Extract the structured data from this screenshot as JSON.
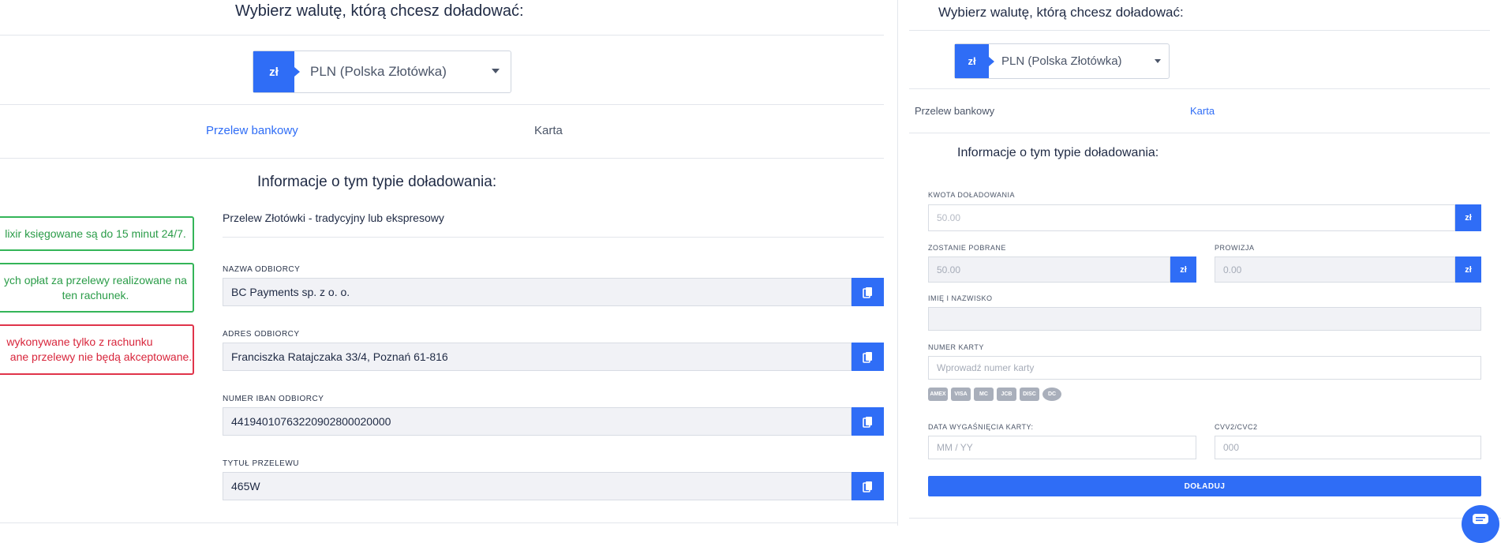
{
  "left": {
    "currency_heading": "Wybierz walutę, którą chcesz doładować:",
    "currency_symbol": "zł",
    "currency_value": "PLN (Polska Złotówka)",
    "tabs": [
      {
        "label": "Przelew bankowy",
        "active": true
      },
      {
        "label": "Karta",
        "active": false
      }
    ],
    "info_heading": "Informacje o tym typie doładowania:",
    "alerts": [
      {
        "type": "success",
        "lines": [
          "lixir księgowane są do 15 minut 24/7."
        ]
      },
      {
        "type": "success",
        "lines": [
          "ych opłat za przelewy realizowane na",
          "ten rachunek."
        ]
      },
      {
        "type": "error",
        "lines": [
          "wykonywane tylko z rachunku",
          "ane przelewy nie będą akceptowane."
        ]
      }
    ],
    "transfer_type": "Przelew Złotówki - tradycyjny lub ekspresowy",
    "fields": [
      {
        "label": "NAZWA ODBIORCY",
        "value": "BC Payments sp. z o. o."
      },
      {
        "label": "ADRES ODBIORCY",
        "value": "Franciszka Ratajczaka 33/4, Poznań 61-816"
      },
      {
        "label": "NUMER IBAN ODBIORCY",
        "value": "44194010763220902800020000"
      },
      {
        "label": "TYTUŁ PRZELEWU",
        "value": "465W"
      }
    ]
  },
  "right": {
    "currency_heading": "Wybierz walutę, którą chcesz doładować:",
    "currency_symbol": "zł",
    "currency_value": "PLN (Polska Złotówka)",
    "tabs": [
      {
        "label": "Przelew bankowy",
        "active": false
      },
      {
        "label": "Karta",
        "active": true
      }
    ],
    "info_heading": "Informacje o tym typie doładowania:",
    "amount_label": "KWOTA DOŁADOWANIA",
    "amount_placeholder": "50.00",
    "amount_unit": "zł",
    "charged_label": "ZOSTANIE POBRANE",
    "charged_value": "50.00",
    "charged_unit": "zł",
    "fee_label": "PROWIZJA",
    "fee_value": "0.00",
    "fee_unit": "zł",
    "name_label": "IMIĘ I NAZWISKO",
    "name_value": "",
    "card_number_label": "NUMER KARTY",
    "card_number_placeholder": "Wprowadź numer karty",
    "card_brands": [
      "amex-icon",
      "visa-icon",
      "mastercard-icon",
      "jcb-icon",
      "discover-icon",
      "diners-icon"
    ],
    "card_brand_labels": [
      "AMEX",
      "VISA",
      "MC",
      "JCB",
      "DISC",
      "DC"
    ],
    "expiry_label": "DATA WYGAŚNIĘCIA KARTY:",
    "expiry_placeholder": "MM / YY",
    "cvv_label": "CVV2/CVC2",
    "cvv_placeholder": "000",
    "submit_label": "DOŁADUJ"
  },
  "colors": {
    "accent": "#2f6df6",
    "success": "#34b558",
    "error": "#e0344a",
    "field_bg": "#f1f2f6"
  }
}
